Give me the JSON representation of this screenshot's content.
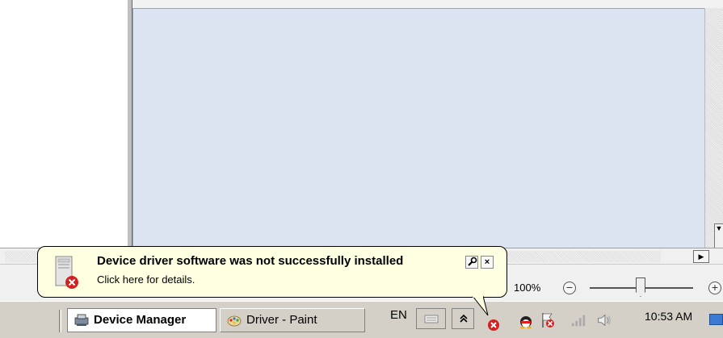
{
  "balloon": {
    "title": "Device driver software was not successfully installed",
    "text": "Click here for details.",
    "options_icon": "wrench-icon",
    "close_glyph": "×"
  },
  "status_bar": {
    "zoom_level": "100%",
    "zoom_minus": "−",
    "zoom_plus": "+",
    "zoom_fraction": 0.47
  },
  "taskbar": {
    "items": [
      {
        "label": "Device Manager",
        "icon": "device-manager-icon",
        "active": true
      },
      {
        "label": "Driver - Paint",
        "icon": "paint-icon",
        "active": false
      }
    ],
    "language": "EN",
    "clock": "10:53 AM",
    "tray_icons": [
      "keyboard-icon",
      "show-hidden-icons-icon",
      "driver-error-icon",
      "qq-icon",
      "action-center-flag-icon",
      "network-icon",
      "volume-icon",
      "show-desktop-icon"
    ]
  },
  "colors": {
    "canvas_bg": "#dbe4f0",
    "balloon_bg": "#ffffe1",
    "error_red": "#d32020"
  }
}
